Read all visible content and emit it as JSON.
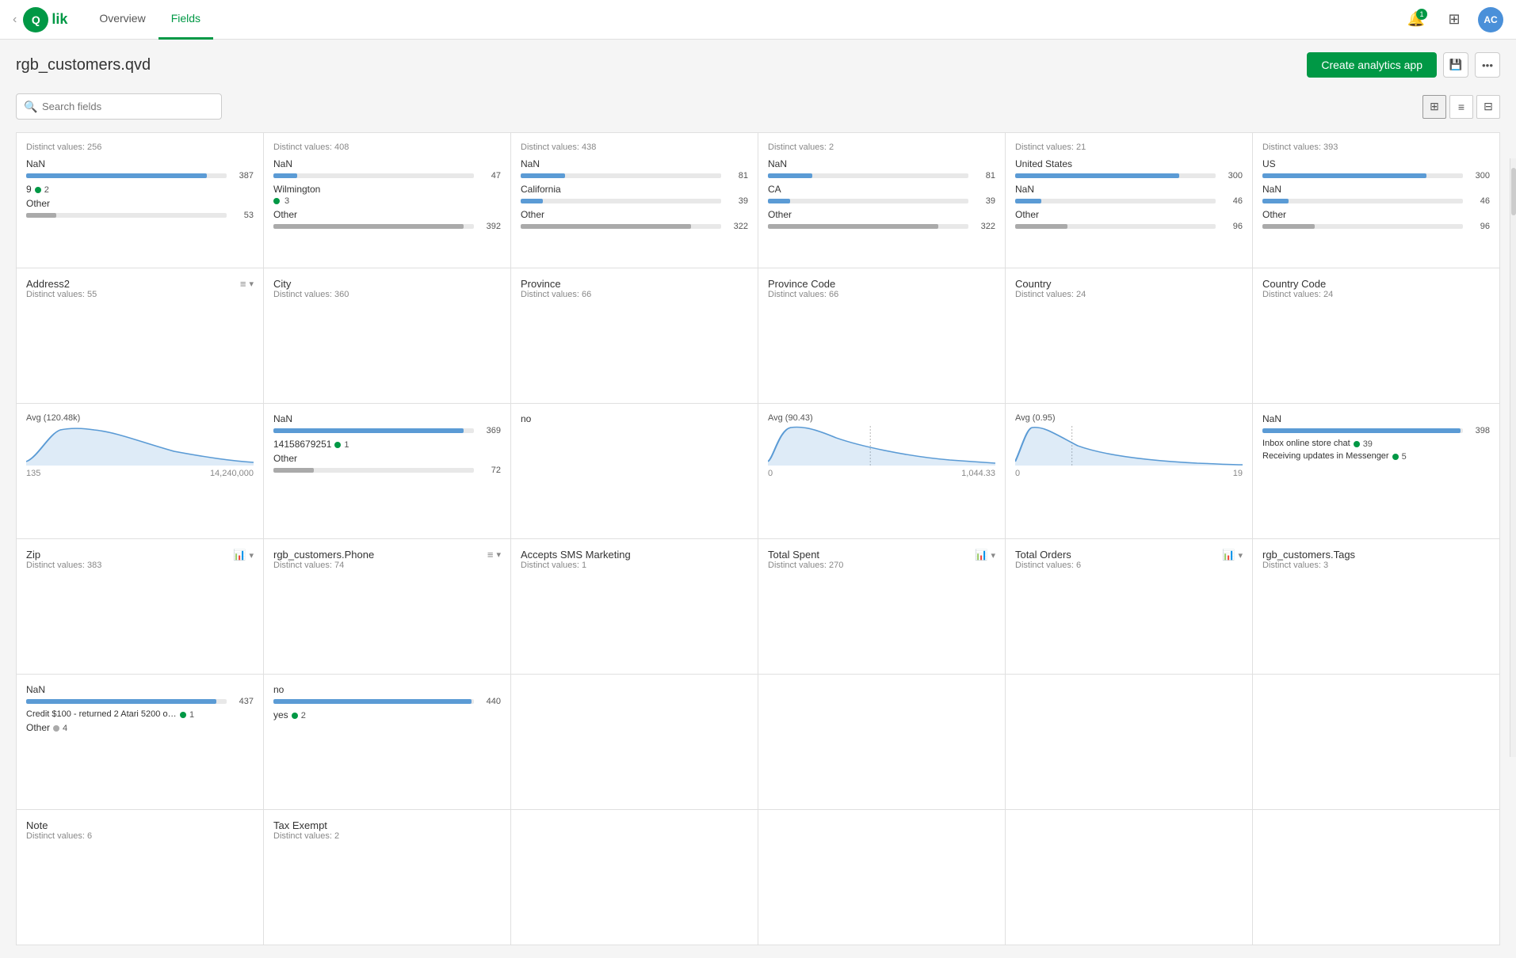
{
  "header": {
    "back_label": "‹",
    "logo_text": "Qlik",
    "logo_circle": "Q",
    "nav": [
      {
        "label": "Overview",
        "active": false
      },
      {
        "label": "Fields",
        "active": true
      }
    ],
    "notification_count": "1",
    "avatar_initials": "AC"
  },
  "page": {
    "title": "rgb_customers.qvd",
    "create_button": "Create analytics app",
    "search_placeholder": "Search fields"
  },
  "view_icons": {
    "grid": "⊞",
    "list": "≡",
    "table": "⊟"
  },
  "fields": [
    {
      "name": "Address2",
      "distinct": "Distinct values: 256",
      "values": [
        {
          "label": "NaN",
          "bar_pct": 90,
          "count": "387"
        },
        {
          "label": "9",
          "dot": true,
          "count": "2"
        },
        {
          "label": "Other",
          "bar_pct": 15,
          "count": "53"
        }
      ],
      "section2": {
        "name": "Address2",
        "distinct": "Distinct values: 55",
        "has_sort_icon": true
      },
      "section3": {
        "chart_type": "histogram",
        "avg_label": "Avg (120.48k)",
        "range_min": "135",
        "range_max": "14,240,000"
      },
      "section4": {
        "name": "Zip",
        "distinct": "Distinct values: 383"
      },
      "section5_values": [
        {
          "label": "NaN",
          "bar_pct": 95,
          "count": "437"
        },
        {
          "label": "Credit $100 - returned 2 Atari 5200 original ...",
          "dot": true,
          "count": "1"
        },
        {
          "label": "Other",
          "dot_count": "4"
        }
      ],
      "section6": {
        "name": "Note",
        "distinct": "Distinct values: 6"
      }
    },
    {
      "name": "City",
      "distinct": "Distinct values: 408",
      "values": [
        {
          "label": "NaN",
          "bar_pct": 12,
          "count": "47"
        },
        {
          "label": "Wilmington",
          "dot": true,
          "count": "3"
        },
        {
          "label": "Other",
          "bar_pct": 99,
          "count": "392"
        }
      ],
      "section2": {
        "name": "City",
        "distinct": "Distinct values: 360",
        "has_sort_icon": true
      },
      "section3": {
        "chart_type": "values",
        "values": [
          {
            "label": "NaN",
            "bar_pct": 95,
            "count": "369"
          },
          {
            "label": "14158679251",
            "dot": true,
            "count": "1"
          },
          {
            "label": "Other",
            "bar_pct": 20,
            "count": "72"
          }
        ]
      },
      "section4": {
        "name": "rgb_customers.Phone",
        "distinct": "Distinct values: 74",
        "has_sort_icon": true
      },
      "section5_values": [
        {
          "label": "no",
          "bar_pct": 99,
          "count": "440"
        },
        {
          "label": "yes",
          "dot": true,
          "count": "2"
        }
      ],
      "section6": {
        "name": "Tax Exempt",
        "distinct": "Distinct values: 2"
      }
    },
    {
      "name": "Province",
      "distinct": "Distinct values: 438",
      "values": [
        {
          "label": "NaN",
          "bar_pct": 22,
          "count": "81"
        },
        {
          "label": "California",
          "bar_pct": 11,
          "count": "39"
        },
        {
          "label": "Other",
          "bar_pct": 89,
          "count": "322"
        }
      ],
      "section2": {
        "name": "Province",
        "distinct": "Distinct values: 66"
      },
      "section3": {
        "chart_type": "values",
        "values": [
          {
            "label": "no",
            "bar_pct": 99,
            "count": ""
          },
          {
            "label": "",
            "bar_pct": 0,
            "count": ""
          }
        ],
        "single_value": "no"
      },
      "section4": {
        "name": "Accepts SMS Marketing",
        "distinct": "Distinct values: 1"
      }
    },
    {
      "name": "Province Code",
      "distinct": "Distinct values: 2",
      "values": [
        {
          "label": "NaN",
          "bar_pct": 22,
          "count": "81"
        },
        {
          "label": "CA",
          "bar_pct": 11,
          "count": "39"
        },
        {
          "label": "Other",
          "bar_pct": 89,
          "count": "322"
        }
      ],
      "section2": {
        "name": "Province Code",
        "distinct": "Distinct values: 66"
      },
      "section3": {
        "chart_type": "histogram",
        "avg_label": "Avg (90.43)",
        "range_min": "0",
        "range_max": "1,044.33",
        "has_chart_icon": true
      },
      "section4": {
        "name": "Total Spent",
        "distinct": "Distinct values: 270",
        "has_chart_icon": true
      }
    },
    {
      "name": "Country",
      "distinct": "Distinct values: 21",
      "values": [
        {
          "label": "United States",
          "bar_pct": 82,
          "count": "300"
        },
        {
          "label": "NaN",
          "bar_pct": 13,
          "count": "46"
        },
        {
          "label": "Other",
          "bar_pct": 26,
          "count": "96"
        }
      ],
      "section2": {
        "name": "Country",
        "distinct": "Distinct values: 24"
      },
      "section3": {
        "chart_type": "histogram",
        "avg_label": "Avg (0.95)",
        "range_min": "0",
        "range_max": "19",
        "has_chart_icon": true
      },
      "section4": {
        "name": "Total Orders",
        "distinct": "Distinct values: 6",
        "has_chart_icon": true
      }
    },
    {
      "name": "Country Code",
      "distinct": "Distinct values: 393",
      "values": [
        {
          "label": "US",
          "bar_pct": 82,
          "count": "300"
        },
        {
          "label": "NaN",
          "bar_pct": 13,
          "count": "46"
        },
        {
          "label": "Other",
          "bar_pct": 26,
          "count": "96"
        }
      ],
      "section2": {
        "name": "Country Code",
        "distinct": "Distinct values: 24"
      },
      "section3": {
        "chart_type": "values",
        "values": [
          {
            "label": "NaN",
            "bar_pct": 99,
            "count": "398"
          },
          {
            "label": "Inbox online store chat",
            "dot": true,
            "count": "39"
          },
          {
            "label": "Receiving updates in Messenger",
            "dot": true,
            "count": "5"
          }
        ]
      },
      "section4": {
        "name": "rgb_customers.Tags",
        "distinct": "Distinct values: 3"
      }
    }
  ]
}
